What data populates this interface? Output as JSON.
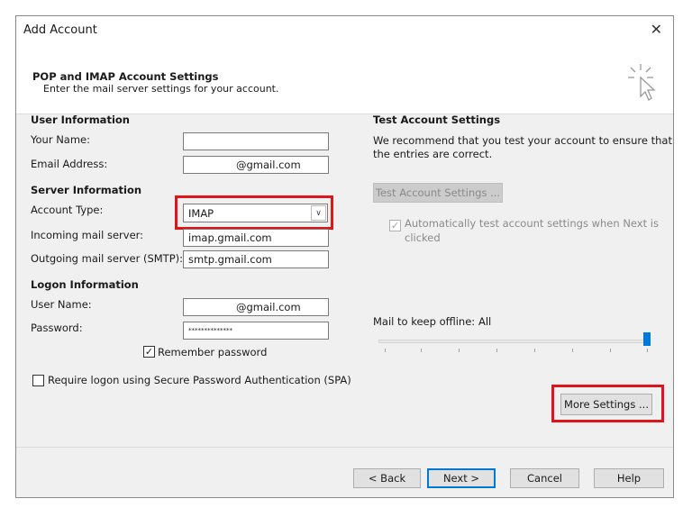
{
  "window": {
    "title": "Add Account",
    "close_glyph": "✕"
  },
  "header": {
    "title": "POP and IMAP Account Settings",
    "subtitle": "Enter the mail server settings for your account.",
    "icon": "cursor-click-icon"
  },
  "user_info": {
    "heading": "User Information",
    "name_label": "Your Name:",
    "name_value": "",
    "email_label": "Email Address:",
    "email_value": "@gmail.com"
  },
  "server_info": {
    "heading": "Server Information",
    "account_type_label": "Account Type:",
    "account_type_value": "IMAP",
    "incoming_label": "Incoming mail server:",
    "incoming_value": "imap.gmail.com",
    "outgoing_label": "Outgoing mail server (SMTP):",
    "outgoing_value": "smtp.gmail.com"
  },
  "logon_info": {
    "heading": "Logon Information",
    "username_label": "User Name:",
    "username_value": "@gmail.com",
    "password_label": "Password:",
    "password_value": "**************",
    "remember_label": "Remember password",
    "remember_checked": true,
    "spa_label": "Require logon using Secure Password Authentication (SPA)",
    "spa_checked": false
  },
  "test_settings": {
    "heading": "Test Account Settings",
    "description_line1": "We recommend that you test your account to ensure that",
    "description_line2": "the entries are correct.",
    "test_button": "Test Account Settings ...",
    "auto_test_line1": "Automatically test account settings when Next is",
    "auto_test_line2": "clicked",
    "auto_test_checked": true
  },
  "offline": {
    "label": "Mail to keep offline:",
    "value": "All",
    "slider_position": 1.0
  },
  "more_settings_button": "More Settings ...",
  "footer": {
    "back": "< Back",
    "next": "Next >",
    "cancel": "Cancel",
    "help": "Help"
  },
  "colors": {
    "highlight": "#e0141b",
    "accent": "#0078d7"
  }
}
